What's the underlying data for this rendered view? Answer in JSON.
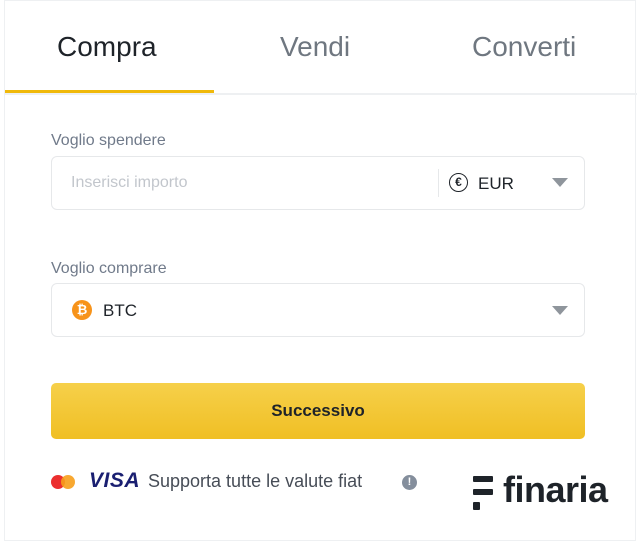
{
  "tabs": [
    {
      "label": "Compra",
      "active": true
    },
    {
      "label": "Vendi",
      "active": false
    },
    {
      "label": "Converti",
      "active": false
    }
  ],
  "spend": {
    "label": "Voglio spendere",
    "placeholder": "Inserisci importo",
    "currency": "EUR",
    "currency_icon": "euro-icon",
    "currency_symbol": "€"
  },
  "buy": {
    "label": "Voglio comprare",
    "coin": "BTC",
    "coin_icon": "bitcoin-icon",
    "coin_symbol": "₿"
  },
  "next_button": {
    "label": "Successivo"
  },
  "footer": {
    "visa": "VISA",
    "text": "Supporta tutte le valute fiat",
    "info_symbol": "!",
    "brand": "finaria"
  },
  "colors": {
    "accent": "#f0b90b",
    "button": "#f0bf24",
    "text": "#1e2329",
    "muted": "#707a8a",
    "bitcoin": "#f7931a"
  }
}
